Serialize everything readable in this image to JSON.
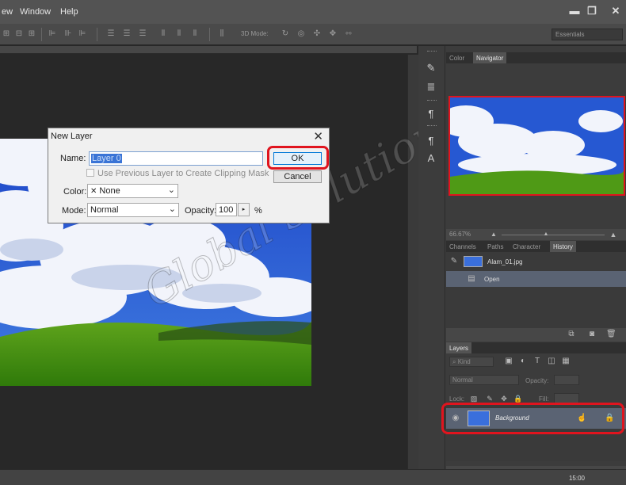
{
  "menu": {
    "items": [
      "ew",
      "Window",
      "Help"
    ]
  },
  "window_controls": {
    "minimize": "▬",
    "restore": "❐",
    "close": "✕"
  },
  "options_bar": {
    "mode3d_label": "3D Mode:",
    "workspace": "Essentials"
  },
  "dialog": {
    "title": "New Layer",
    "close": "✕",
    "name_label": "Name:",
    "name_value": "Layer 0",
    "clipping_label": "Use Previous Layer to Create Clipping Mask",
    "color_label": "Color:",
    "color_value": "None",
    "color_swatch": "✕",
    "mode_label": "Mode:",
    "mode_value": "Normal",
    "opacity_label": "Opacity:",
    "opacity_value": "100",
    "opacity_arrow": "▸",
    "opacity_unit": "%",
    "ok_label": "OK",
    "cancel_label": "Cancel"
  },
  "watermark": "Global Solutions",
  "panels": {
    "top_tabs": [
      "Color",
      "Navigator"
    ],
    "navigator_zoom": "66.67%",
    "history_tabs": [
      "Channels",
      "Paths",
      "Character",
      "History"
    ],
    "history_items": [
      {
        "label": "Alam_01.jpg",
        "selected": false
      },
      {
        "label": "Open",
        "selected": true
      }
    ],
    "layers_tab": "Layers",
    "kind_label": "Kind",
    "blend_mode": "Normal",
    "opacity_label": "Opacity:",
    "lock_label": "Lock:",
    "fill_label": "Fill:",
    "layer_name": "Background"
  },
  "status": {
    "time": "15:00"
  },
  "colors": {
    "highlight": "#e0141e",
    "selection": "#5a6373",
    "dialog_accent": "#0078d7"
  }
}
